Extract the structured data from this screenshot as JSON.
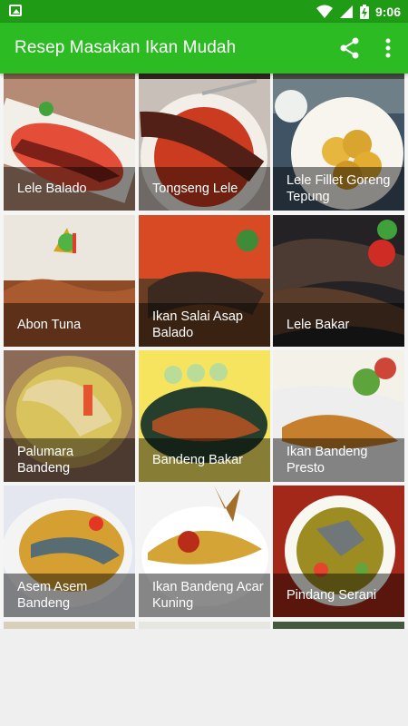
{
  "status": {
    "time": "9:06",
    "icons": [
      "image-notification-icon",
      "wifi-icon",
      "signal-icon",
      "battery-icon"
    ]
  },
  "appbar": {
    "title": "Resep Masakan Ikan Mudah",
    "actions": [
      "share-icon",
      "more-vert-icon"
    ]
  },
  "colors": {
    "statusbar": "#1f9b16",
    "appbar": "#2dbb24"
  },
  "recipes": [
    {
      "label": "Lele Balado"
    },
    {
      "label": "Tongseng Lele"
    },
    {
      "label": "Lele Fillet Goreng Tepung"
    },
    {
      "label": "Abon Tuna"
    },
    {
      "label": "Ikan Salai Asap Balado"
    },
    {
      "label": "Lele Bakar"
    },
    {
      "label": "Palumara Bandeng"
    },
    {
      "label": "Bandeng Bakar"
    },
    {
      "label": "Ikan Bandeng Presto"
    },
    {
      "label": "Asem Asem Bandeng"
    },
    {
      "label": "Ikan Bandeng Acar Kuning"
    },
    {
      "label": "Pindang Serani"
    }
  ]
}
